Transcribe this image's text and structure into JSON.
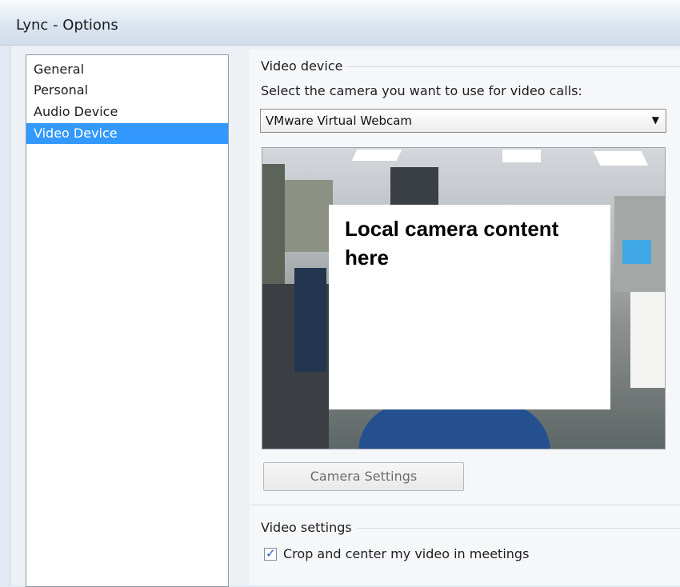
{
  "window": {
    "title": "Lync - Options"
  },
  "sidebar": {
    "items": [
      {
        "label": "General",
        "selected": false
      },
      {
        "label": "Personal",
        "selected": false
      },
      {
        "label": "Audio Device",
        "selected": false
      },
      {
        "label": "Video Device",
        "selected": true
      }
    ]
  },
  "video_device": {
    "group_label": "Video device",
    "prompt": "Select the camera you want to use for video calls:",
    "camera_select": {
      "value": "VMware Virtual Webcam"
    },
    "preview_overlay_text": "Local camera content here",
    "camera_settings_button": "Camera Settings"
  },
  "video_settings": {
    "group_label": "Video settings",
    "crop_checkbox": {
      "label": "Crop and center my video in meetings",
      "checked": true
    }
  },
  "colors": {
    "selection": "#3399ff",
    "checkmark": "#2a54c4"
  },
  "icons": {
    "dropdown": "triangle-down-icon",
    "check": "checkmark-icon"
  }
}
